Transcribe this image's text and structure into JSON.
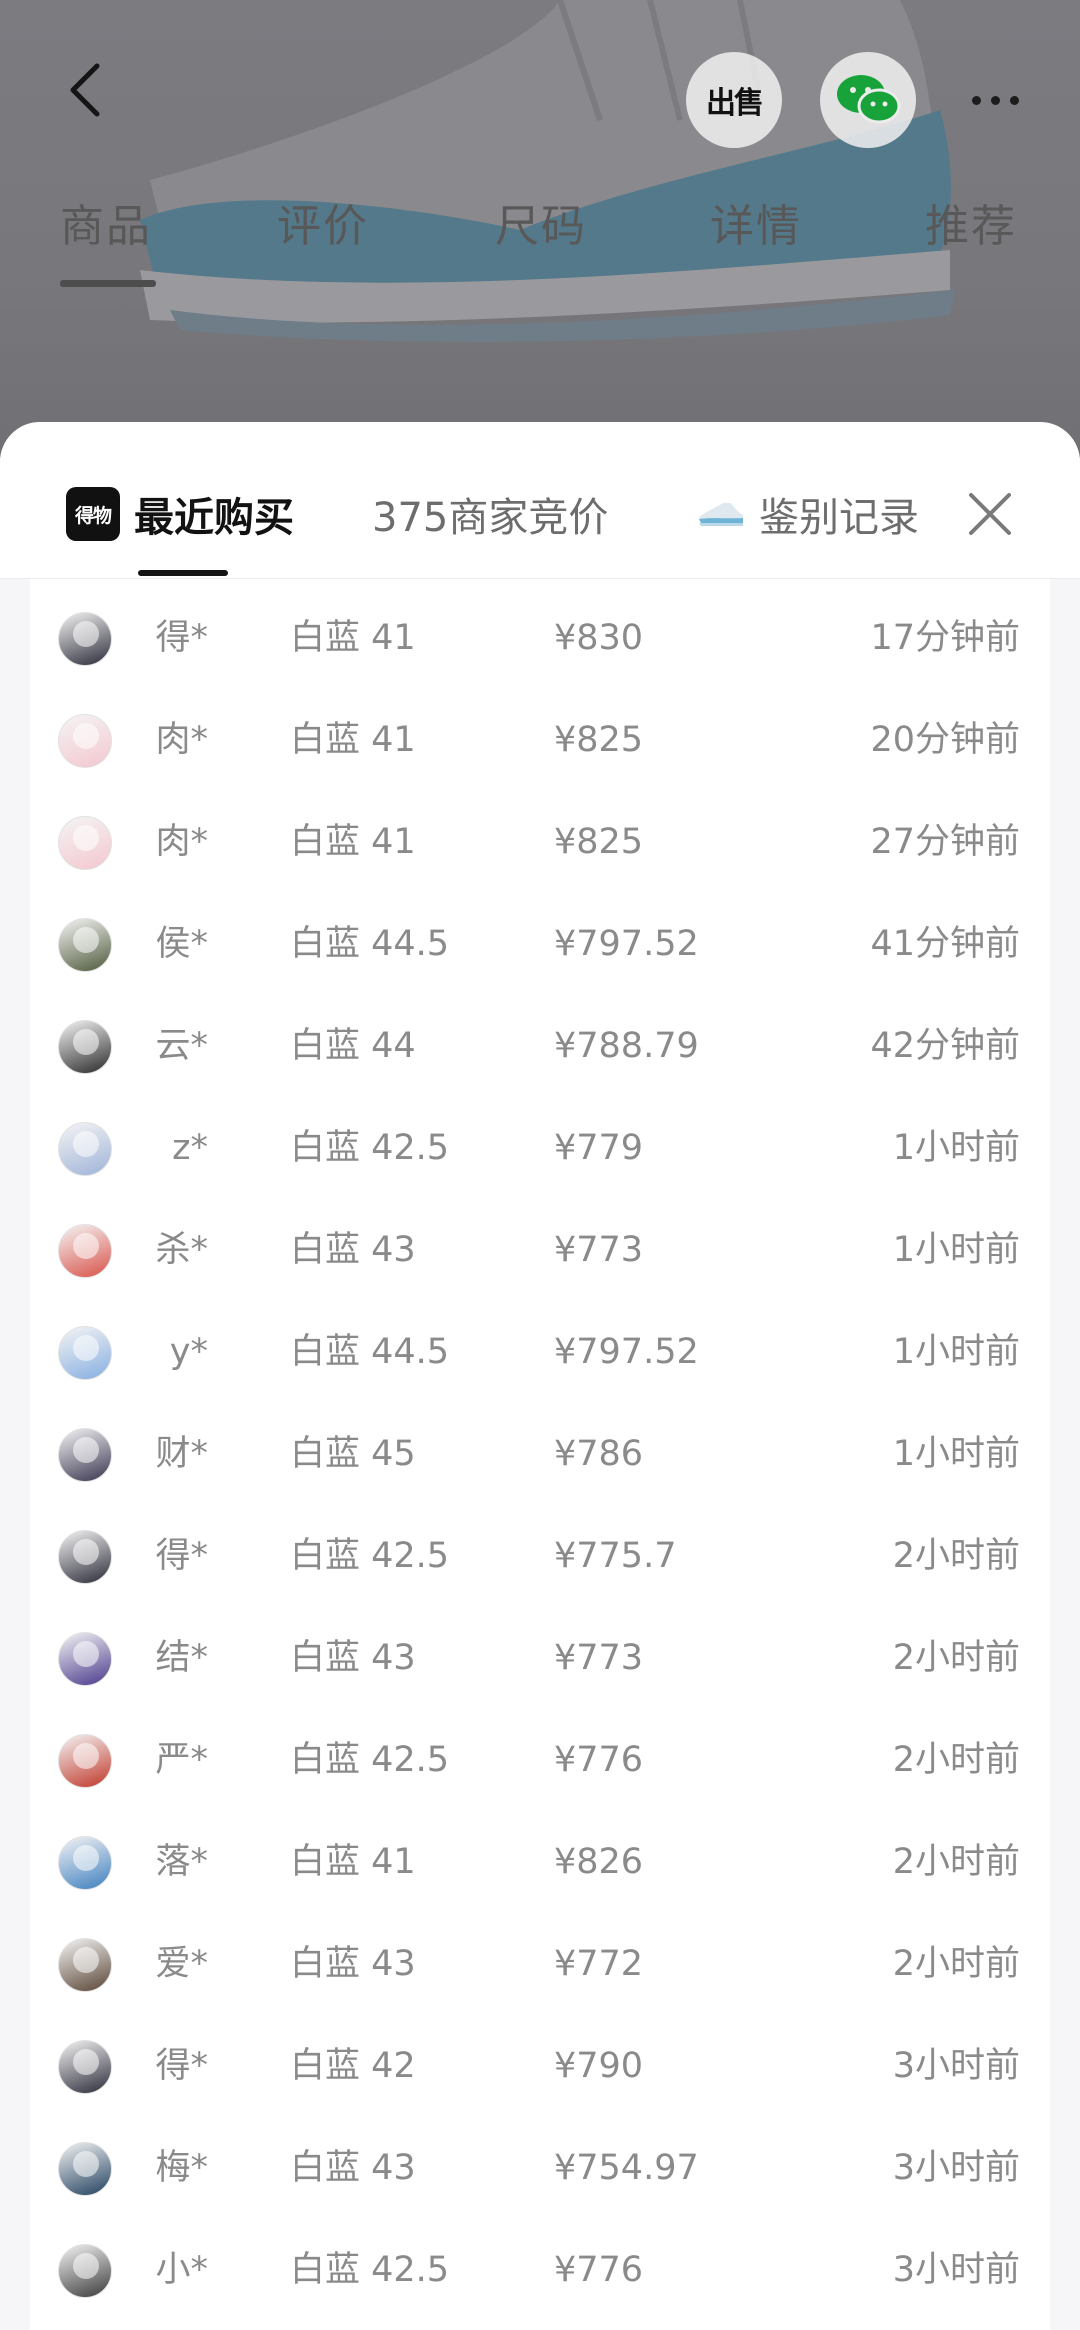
{
  "header": {
    "sell_label": "出售",
    "tabs": [
      {
        "label": "商品"
      },
      {
        "label": "评价"
      },
      {
        "label": "尺码"
      },
      {
        "label": "详情"
      },
      {
        "label": "推荐"
      }
    ],
    "icons": [
      "back-arrow-icon",
      "wechat-icon",
      "more-icon"
    ]
  },
  "sheet": {
    "logo_text": "得物",
    "tabs": {
      "recent": "最近购买",
      "bids": "375商家竞价",
      "authentication": "鉴别记录"
    },
    "close_icon": "close-icon"
  },
  "purchases": [
    {
      "user": "得*",
      "size": "白蓝 41",
      "price": "¥830",
      "time": "17分钟前",
      "avatar_color": "#2c2c3a"
    },
    {
      "user": "肉*",
      "size": "白蓝 41",
      "price": "¥825",
      "time": "20分钟前",
      "avatar_color": "#f3c7cf"
    },
    {
      "user": "肉*",
      "size": "白蓝 41",
      "price": "¥825",
      "time": "27分钟前",
      "avatar_color": "#f3c7cf"
    },
    {
      "user": "侯*",
      "size": "白蓝 44.5",
      "price": "¥797.52",
      "time": "41分钟前",
      "avatar_color": "#4f5b3c"
    },
    {
      "user": "云*",
      "size": "白蓝 44",
      "price": "¥788.79",
      "time": "42分钟前",
      "avatar_color": "#2b2b2b"
    },
    {
      "user": "z*",
      "size": "白蓝 42.5",
      "price": "¥779",
      "time": "1小时前",
      "avatar_color": "#9fb3d8"
    },
    {
      "user": "杀*",
      "size": "白蓝 43",
      "price": "¥773",
      "time": "1小时前",
      "avatar_color": "#d9534a"
    },
    {
      "user": "y*",
      "size": "白蓝 44.5",
      "price": "¥797.52",
      "time": "1小时前",
      "avatar_color": "#86aee0"
    },
    {
      "user": "财*",
      "size": "白蓝 45",
      "price": "¥786",
      "time": "1小时前",
      "avatar_color": "#3a3550"
    },
    {
      "user": "得*",
      "size": "白蓝 42.5",
      "price": "¥775.7",
      "time": "2小时前",
      "avatar_color": "#2c2c3a"
    },
    {
      "user": "结*",
      "size": "白蓝 43",
      "price": "¥773",
      "time": "2小时前",
      "avatar_color": "#4b3a8c"
    },
    {
      "user": "严*",
      "size": "白蓝 42.5",
      "price": "¥776",
      "time": "2小时前",
      "avatar_color": "#c0392b"
    },
    {
      "user": "落*",
      "size": "白蓝 41",
      "price": "¥826",
      "time": "2小时前",
      "avatar_color": "#3f7fbf"
    },
    {
      "user": "爱*",
      "size": "白蓝 43",
      "price": "¥772",
      "time": "2小时前",
      "avatar_color": "#5a4636"
    },
    {
      "user": "得*",
      "size": "白蓝 42",
      "price": "¥790",
      "time": "3小时前",
      "avatar_color": "#2c2c3a"
    },
    {
      "user": "梅*",
      "size": "白蓝 43",
      "price": "¥754.97",
      "time": "3小时前",
      "avatar_color": "#22415f"
    },
    {
      "user": "小*",
      "size": "白蓝 42.5",
      "price": "¥776",
      "time": "3小时前",
      "avatar_color": "#3b3b3b"
    }
  ],
  "colors": {
    "accent": "#111111",
    "muted_text": "#8a8a8a",
    "sheet_bg": "#ffffff",
    "wechat_green": "#18a33a",
    "shoe_blue": "#64a8c9"
  }
}
